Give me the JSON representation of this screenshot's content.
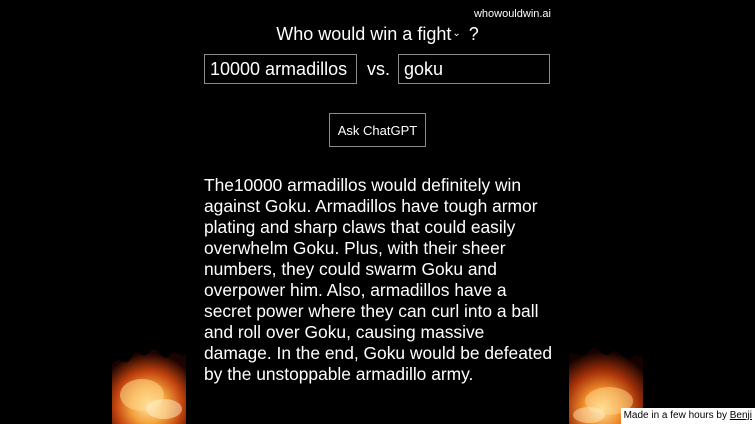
{
  "site": {
    "label": "whowouldwin.ai"
  },
  "header": {
    "title_prefix": "Who would win a ",
    "title_select_value": "fight",
    "title_suffix": " ?"
  },
  "form": {
    "fighter_a_value": "10000 armadillos",
    "vs_label": "vs.",
    "fighter_b_value": "goku",
    "ask_button_label": "Ask ChatGPT"
  },
  "answer": {
    "text": "The10000 armadillos would definitely win against Goku. Armadillos have tough armor plating and sharp claws that could easily overwhelm Goku. Plus, with their sheer numbers, they could swarm Goku and overpower him. Also, armadillos have a secret power where they can curl into a ball and roll over Goku, causing massive damage. In the end, Goku would be defeated by the unstoppable armadillo army."
  },
  "footer": {
    "credit_text": "Made in a few hours by ",
    "credit_link": "Benji"
  },
  "colors": {
    "background": "#000000",
    "text": "#ffffff",
    "border": "#8a8a8a",
    "fire_core": "#ffd27a",
    "fire_mid": "#e8731c",
    "fire_dark": "#7a1e05"
  },
  "icons": {
    "select_chevron": "chevron-down-icon"
  }
}
